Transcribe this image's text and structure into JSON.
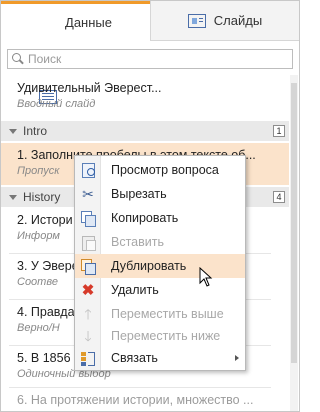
{
  "tabs": [
    {
      "label": "Данные",
      "icon": "list-icon",
      "active": true
    },
    {
      "label": "Слайды",
      "icon": "slides-icon",
      "active": false
    }
  ],
  "search": {
    "placeholder": "Поиск"
  },
  "intro_item": {
    "title": "Удивительный Эверест...",
    "subtitle": "Вводный слайд"
  },
  "groups": [
    {
      "name": "Intro",
      "count": "1"
    },
    {
      "name": "History",
      "count": "4"
    }
  ],
  "questions": [
    {
      "title": "1. Заполните пробелы в этом тексте об...",
      "subtitle": "Пропуск"
    },
    {
      "title": "2. Истори",
      "subtitle": "Информ"
    },
    {
      "title": "3. У Эвере",
      "subtitle": "Соотве"
    },
    {
      "title": "4. Правда",
      "subtitle": "Верно/Н"
    },
    {
      "title": "5. В 1856",
      "subtitle": "Одиночный выбор"
    },
    {
      "title": "6. На протяжении истории, множество ...",
      "subtitle": ""
    }
  ],
  "context_menu": {
    "items": [
      {
        "label": "Просмотр вопроса",
        "icon": "preview-icon",
        "enabled": true
      },
      {
        "label": "Вырезать",
        "icon": "cut-icon",
        "enabled": true
      },
      {
        "label": "Копировать",
        "icon": "copy-icon",
        "enabled": true
      },
      {
        "label": "Вставить",
        "icon": "paste-icon",
        "enabled": false
      },
      {
        "label": "Дублировать",
        "icon": "duplicate-icon",
        "enabled": true,
        "hovered": true
      },
      {
        "label": "Удалить",
        "icon": "delete-icon",
        "enabled": true
      },
      {
        "label": "Переместить выше",
        "icon": "arrow-up-icon",
        "enabled": false
      },
      {
        "label": "Переместить ниже",
        "icon": "arrow-down-icon",
        "enabled": false
      },
      {
        "label": "Связать",
        "icon": "link-icon",
        "enabled": true,
        "submenu": true
      }
    ]
  },
  "colors": {
    "accent": "#f09a2a",
    "selection": "#fbe3cb",
    "delete": "#d63a2a"
  }
}
